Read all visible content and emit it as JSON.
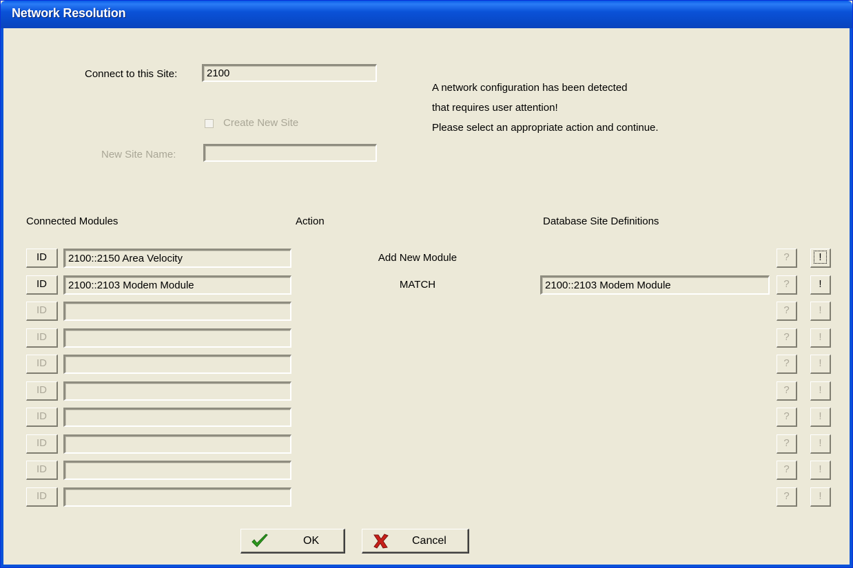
{
  "window": {
    "title": "Network Resolution"
  },
  "site": {
    "connect_label": "Connect to this Site:",
    "connect_value": "2100",
    "create_new_label": "Create New Site",
    "new_name_label": "New Site Name:",
    "new_name_value": ""
  },
  "message": {
    "line1": "A network configuration has been detected",
    "line2": "that requires user attention!",
    "line3": "Please select an appropriate action and continue."
  },
  "headers": {
    "connected": "Connected Modules",
    "action": "Action",
    "database": "Database Site Definitions"
  },
  "rows": [
    {
      "id": "ID",
      "module": "2100::2150 Area Velocity",
      "action": "Add New Module",
      "db": "",
      "q": "?",
      "x": "!",
      "enabled": true
    },
    {
      "id": "ID",
      "module": "2100::2103 Modem Module",
      "action": "MATCH",
      "db": "2100::2103 Modem Module",
      "q": "?",
      "x": "!",
      "enabled": true
    },
    {
      "id": "ID",
      "module": "",
      "action": "",
      "db": "",
      "q": "?",
      "x": "!",
      "enabled": false
    },
    {
      "id": "ID",
      "module": "",
      "action": "",
      "db": "",
      "q": "?",
      "x": "!",
      "enabled": false
    },
    {
      "id": "ID",
      "module": "",
      "action": "",
      "db": "",
      "q": "?",
      "x": "!",
      "enabled": false
    },
    {
      "id": "ID",
      "module": "",
      "action": "",
      "db": "",
      "q": "?",
      "x": "!",
      "enabled": false
    },
    {
      "id": "ID",
      "module": "",
      "action": "",
      "db": "",
      "q": "?",
      "x": "!",
      "enabled": false
    },
    {
      "id": "ID",
      "module": "",
      "action": "",
      "db": "",
      "q": "?",
      "x": "!",
      "enabled": false
    },
    {
      "id": "ID",
      "module": "",
      "action": "",
      "db": "",
      "q": "?",
      "x": "!",
      "enabled": false
    },
    {
      "id": "ID",
      "module": "",
      "action": "",
      "db": "",
      "q": "?",
      "x": "!",
      "enabled": false
    }
  ],
  "buttons": {
    "ok": "OK",
    "cancel": "Cancel"
  },
  "colors": {
    "titlebar": "#0a52d8",
    "ok_icon": "#2e9a1e",
    "cancel_icon": "#c8201a",
    "face": "#ece9d8"
  }
}
